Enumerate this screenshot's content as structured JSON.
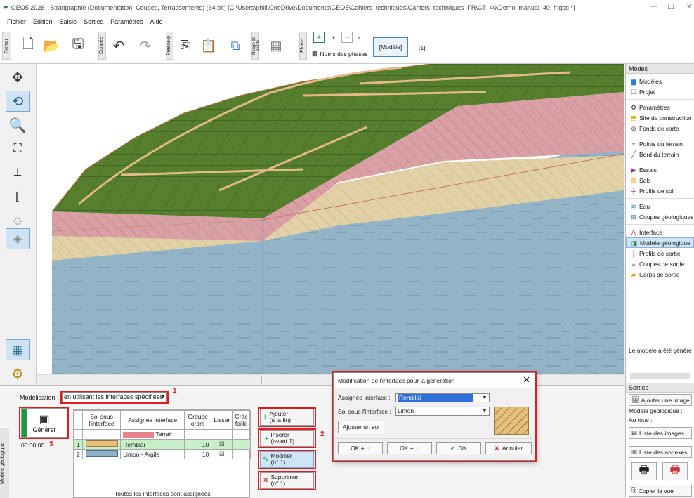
{
  "window": {
    "title": "GEO5 2026 - Stratigraphie (Documentation, Coupes, Terrassements) (64 bit) [C:\\Users\\phili\\OneDrive\\Documents\\GEO5\\Cahiers_techniques\\Cahiers_techniques_FR\\CT_40\\Demo_manual_40_fr.gsg *]",
    "minimize": "—",
    "maximize": "☐",
    "close": "✕"
  },
  "menu": [
    "Fichier",
    "Edition",
    "Saisie",
    "Sorties",
    "Paramètres",
    "Aide"
  ],
  "toolbar": {
    "file_label": "Fichier",
    "data_label": "Donnée",
    "clipboard_label": "Presse-p",
    "cloud_label": "Nuage de points",
    "phase_label": "Phase",
    "phase_names": "Noms des phases",
    "model_tab": "[Modèle]",
    "stage_tab": "[1]"
  },
  "modes": {
    "header": "Modes",
    "items": [
      {
        "label": "Modèles",
        "icon": "models-icon",
        "color": "#2a7bd6"
      },
      {
        "label": "Projet",
        "icon": "project-icon",
        "color": "#555"
      },
      {
        "label": "Paramètres",
        "icon": "settings-icon",
        "color": "#333"
      },
      {
        "label": "Site de construction",
        "icon": "site-icon",
        "color": "#e8a20c"
      },
      {
        "label": "Fonds de carte",
        "icon": "map-icon",
        "color": "#444"
      },
      {
        "label": "Points du terrain",
        "icon": "terrain-points-icon",
        "color": "#777"
      },
      {
        "label": "Bord du terrain",
        "icon": "terrain-edge-icon",
        "color": "#a0329e"
      },
      {
        "label": "Essais",
        "icon": "tests-icon",
        "color": "#a0329e"
      },
      {
        "label": "Sols",
        "icon": "soils-icon",
        "color": "#e8a20c"
      },
      {
        "label": "Profils de sol",
        "icon": "soil-profiles-icon",
        "color": "#d04040"
      },
      {
        "label": "Eau",
        "icon": "water-icon",
        "color": "#2a7bd6"
      },
      {
        "label": "Coupes géologiques",
        "icon": "geo-sections-icon",
        "color": "#2a7bd6"
      },
      {
        "label": "Interface",
        "icon": "interface-icon",
        "color": "#d04040"
      },
      {
        "label": "Modèle géologique",
        "icon": "geo-model-icon",
        "color": "#2a8a4a"
      },
      {
        "label": "Profils de sortie",
        "icon": "output-profiles-icon",
        "color": "#d04040"
      },
      {
        "label": "Coupes de sortie",
        "icon": "output-sections-icon",
        "color": "#d04040"
      },
      {
        "label": "Corps de sortie",
        "icon": "output-bodies-icon",
        "color": "#e8a20c"
      }
    ],
    "status": "Le modèle a été généré"
  },
  "outputs": {
    "header": "Sorties",
    "add_image": "Ajouter une image",
    "model_label": "Modèle géologique :",
    "total_label": "Au total :",
    "list_images": "Liste des images",
    "list_annexes": "Liste des annexes",
    "copy_view": "Copier la vue"
  },
  "bottom": {
    "panel_label": "Modèle géologique",
    "modelisation_label": "Modélisation :",
    "modelisation_value": "en utilisant les interfaces spécifiées",
    "generate": "Générer",
    "timer": "00:00:00",
    "callouts": [
      "1",
      "2",
      "3"
    ],
    "table": {
      "headers": [
        "",
        "Sol sous l'interface",
        "Assignée interface",
        "Groupe ordre",
        "Lisser",
        "Crée faille"
      ],
      "rows": [
        {
          "num": "",
          "soil": "",
          "interface": "Terrain",
          "group": "",
          "smooth": "",
          "fault": ""
        },
        {
          "num": "1",
          "soil": "",
          "interface": "Remblai",
          "group": "10",
          "smooth": "☑",
          "fault": ""
        },
        {
          "num": "2",
          "soil": "",
          "interface": "Limon - Argile",
          "group": "10",
          "smooth": "☑",
          "fault": ""
        }
      ],
      "footer": "Toutes les interfaces sont assignées."
    },
    "buttons": [
      {
        "label": "Ajouter",
        "sub": "(à la fin)"
      },
      {
        "label": "Insérer",
        "sub": "(avant 1)"
      },
      {
        "label": "Modifier",
        "sub": "(n° 1)"
      },
      {
        "label": "Supprimer",
        "sub": "(n° 1)"
      }
    ]
  },
  "dialog": {
    "title": "Modification de l'interface pour la génération",
    "close": "✕",
    "assigned_label": "Assignée interface :",
    "assigned_value": "Remblai",
    "soil_label": "Sol sous l'interface :",
    "soil_value": "Limon",
    "add_soil": "Ajouter un sol",
    "ok_up": "OK +",
    "ok_down": "OK +",
    "ok": "OK",
    "cancel": "Annuler"
  },
  "colors": {
    "accent_red": "#e01b22",
    "selection": "#cde3f7",
    "grass": "#4e7a2c",
    "fill_red": "#d9a2a6",
    "sand": "#e3d0a8",
    "rock": "#8fb0c6"
  }
}
